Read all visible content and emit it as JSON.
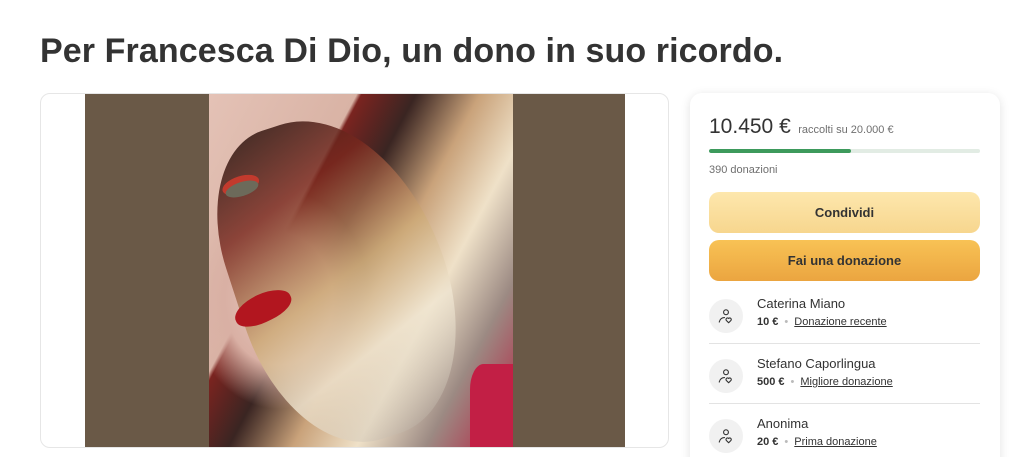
{
  "page": {
    "title": "Per Francesca Di Dio, un dono in suo ricordo."
  },
  "media": {
    "image_alt": "Foto di Francesca Di Dio"
  },
  "fundraiser": {
    "raised_amount": "10.450 €",
    "raised_of": "raccolti su 20.000 €",
    "progress_fraction": 0.5225,
    "donations_count": "390 donazioni",
    "share_label": "Condividi",
    "donate_label": "Fai una donazione",
    "accent_color": "#3d9a5c",
    "donate_color": "#eba540",
    "share_color": "#f7d68e"
  },
  "donors": [
    {
      "name": "Caterina Miano",
      "amount": "10 €",
      "tag": "Donazione recente",
      "icon": "hand-heart-icon"
    },
    {
      "name": "Stefano Caporlingua",
      "amount": "500 €",
      "tag": "Migliore donazione",
      "icon": "hand-heart-icon"
    },
    {
      "name": "Anonima",
      "amount": "20 €",
      "tag": "Prima donazione",
      "icon": "hand-heart-icon"
    }
  ]
}
